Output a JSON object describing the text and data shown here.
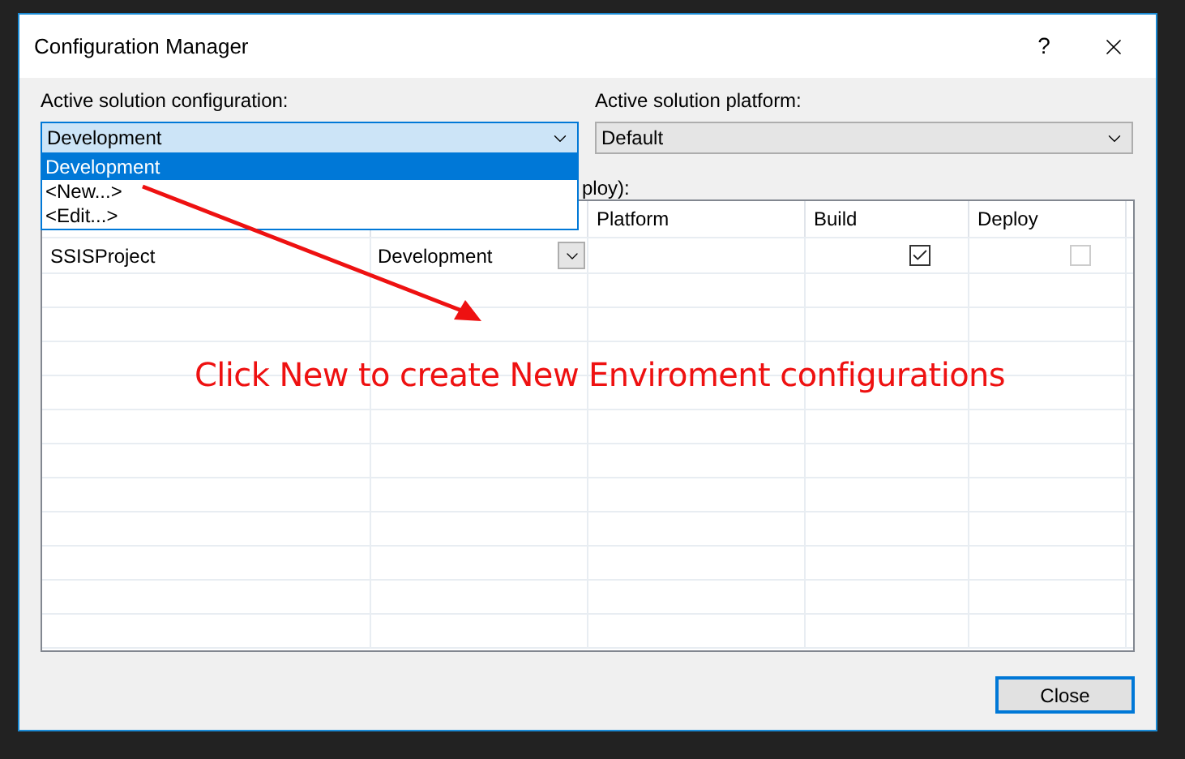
{
  "window": {
    "title": "Configuration Manager",
    "help": "?"
  },
  "active_configuration": {
    "label": "Active solution configuration:",
    "value": "Development",
    "expanded": true,
    "options": [
      {
        "label": "Development",
        "selected": true
      },
      {
        "label": "<New...>",
        "selected": false
      },
      {
        "label": "<Edit...>",
        "selected": false
      }
    ]
  },
  "active_platform": {
    "label": "Active solution platform:",
    "value": "Default"
  },
  "contexts_label": "ploy):",
  "table": {
    "columns": [
      "",
      "",
      "Platform",
      "Build",
      "Deploy"
    ],
    "rows": [
      {
        "project": "SSISProject",
        "configuration": "Development",
        "platform": "",
        "build": true,
        "deploy": false,
        "deploy_disabled": true
      }
    ]
  },
  "annotation": {
    "text": "Click New to create New Enviroment configurations"
  },
  "buttons": [
    "Close"
  ]
}
